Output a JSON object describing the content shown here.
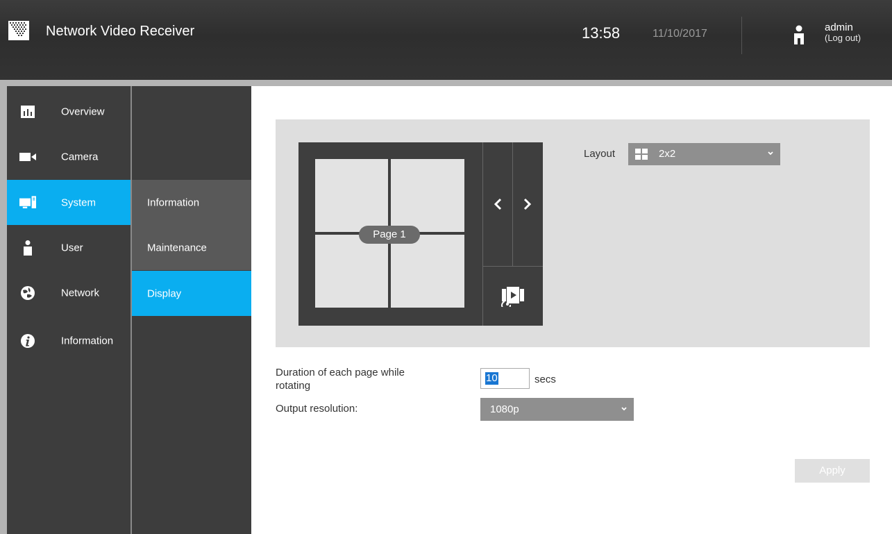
{
  "header": {
    "title": "Network Video Receiver",
    "time": "13:58",
    "date": "11/10/2017",
    "username": "admin",
    "logout": "(Log out)"
  },
  "sidebar": {
    "items": [
      {
        "label": "Overview",
        "icon": "bar-chart-icon"
      },
      {
        "label": "Camera",
        "icon": "video-camera-icon"
      },
      {
        "label": "System",
        "icon": "computer-icon",
        "active": true
      },
      {
        "label": "User",
        "icon": "user-icon"
      },
      {
        "label": "Network",
        "icon": "globe-icon"
      },
      {
        "label": "Information",
        "icon": "info-icon"
      }
    ]
  },
  "submenu": {
    "items": [
      {
        "label": "Information"
      },
      {
        "label": "Maintenance"
      },
      {
        "label": "Display",
        "active": true
      }
    ]
  },
  "preview": {
    "page_label": "Page 1",
    "layout_label": "Layout",
    "layout_value": "2x2"
  },
  "form": {
    "duration_label": "Duration of each page while rotating",
    "duration_value": "10",
    "duration_unit": "secs",
    "resolution_label": "Output resolution:",
    "resolution_value": "1080p"
  },
  "apply_label": "Apply",
  "colors": {
    "accent": "#0aaef0",
    "header_bg": "#333333",
    "sidebar_bg": "#3d3d3d",
    "panel_bg": "#dedede",
    "select_bg": "#8f8f8f"
  }
}
